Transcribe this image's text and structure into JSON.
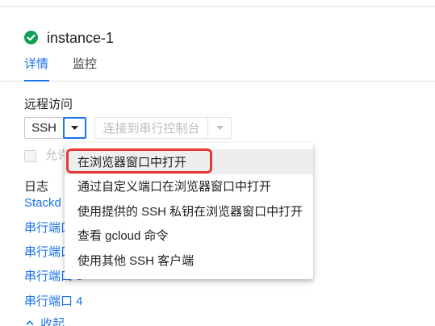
{
  "colors": {
    "accent": "#1a73e8",
    "status_ok": "#0f9d58",
    "annotation": "#e53935"
  },
  "instance": {
    "name": "instance-1",
    "status_icon": "check-circle-icon"
  },
  "tabs": [
    {
      "label": "详情",
      "selected": true
    },
    {
      "label": "监控",
      "selected": false
    }
  ],
  "remote_access": {
    "label": "远程访问",
    "ssh_button": {
      "label": "SSH",
      "icon": "triangle-down-icon",
      "focused": true
    },
    "serial_console_button": {
      "label": "连接到串行控制台",
      "icon": "triangle-down-icon",
      "disabled": true
    },
    "serial_port_checkbox": {
      "label": "允许",
      "checked": false,
      "disabled": true
    }
  },
  "logs": {
    "label": "日志",
    "links": [
      "Stackd",
      "串行端口",
      "串行端口",
      "串行端口 3",
      "串行端口 4"
    ],
    "collapse": {
      "icon": "chevron-up-icon",
      "label": "收起"
    }
  },
  "ssh_menu": {
    "open": true,
    "highlighted_index": 0,
    "items": [
      "在浏览器窗口中打开",
      "通过自定义端口在浏览器窗口中打开",
      "使用提供的 SSH 私钥在浏览器窗口中打开",
      "查看 gcloud 命令",
      "使用其他 SSH 客户端"
    ]
  }
}
